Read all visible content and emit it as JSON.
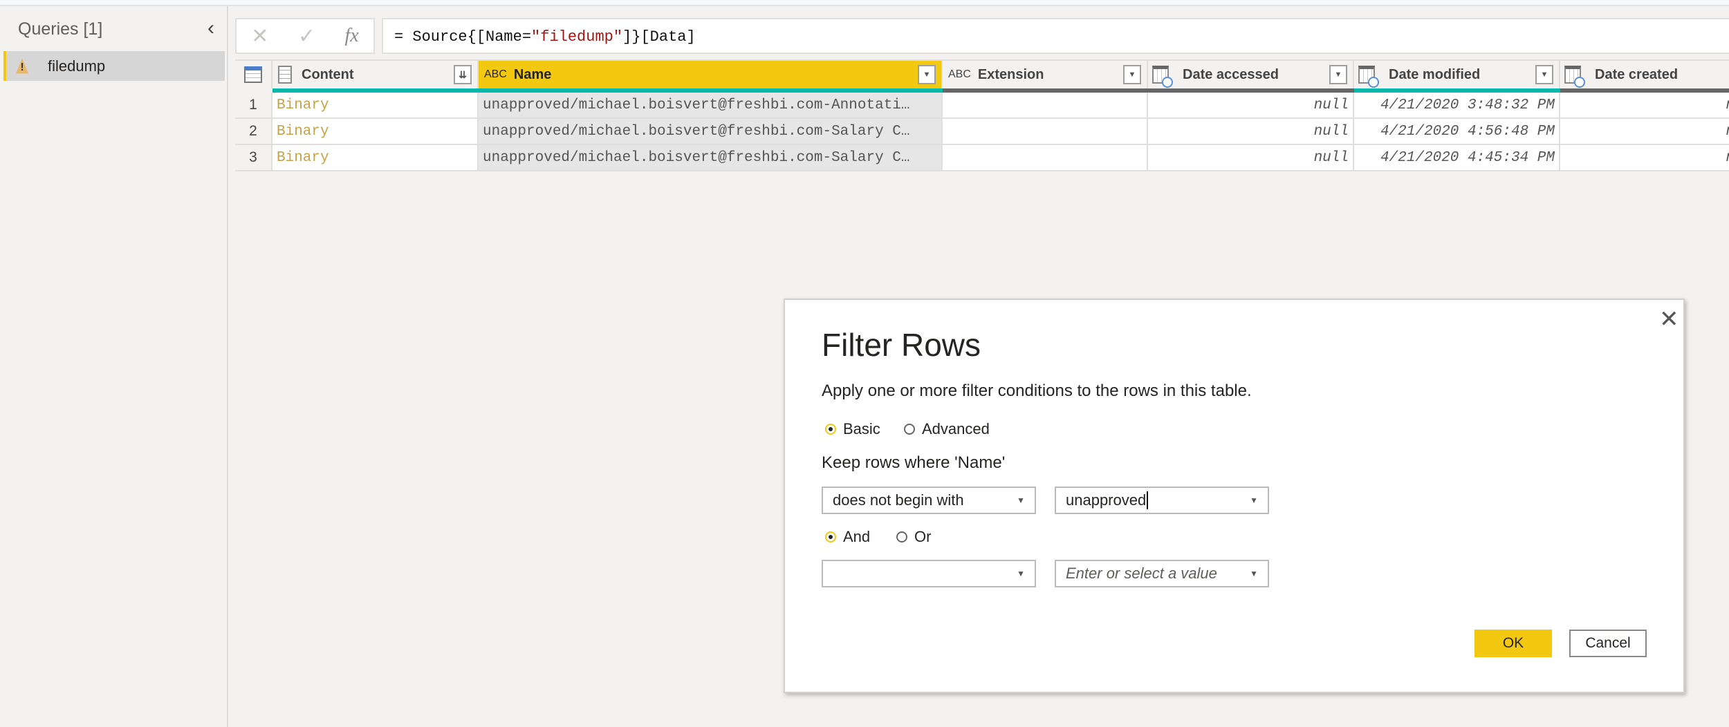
{
  "queries_pane": {
    "title": "Queries [1]",
    "items": [
      {
        "label": "filedump",
        "status": "warning"
      }
    ]
  },
  "formula_bar": {
    "cancel": "✕",
    "commit": "✓",
    "fx": "fx",
    "prefix": "= Source{[Name=",
    "string": "\"filedump\"",
    "suffix": "]}[Data]"
  },
  "table": {
    "columns": [
      {
        "label": "Content",
        "type_icon": "binary-icon"
      },
      {
        "label": "Name",
        "type_icon": "text-icon",
        "type_text": "ABC",
        "selected": true
      },
      {
        "label": "Extension",
        "type_icon": "text-icon",
        "type_text": "ABC"
      },
      {
        "label": "Date accessed",
        "type_icon": "datetime-icon"
      },
      {
        "label": "Date modified",
        "type_icon": "datetime-icon"
      },
      {
        "label": "Date created",
        "type_icon": "datetime-icon"
      }
    ],
    "rows": [
      {
        "n": "1",
        "content": "Binary",
        "name": "unapproved/michael.boisvert@freshbi.com-Annotati…",
        "extension": "",
        "date_accessed": "null",
        "date_modified": "4/21/2020 3:48:32 PM",
        "date_created": "n"
      },
      {
        "n": "2",
        "content": "Binary",
        "name": "unapproved/michael.boisvert@freshbi.com-Salary C…",
        "extension": "",
        "date_accessed": "null",
        "date_modified": "4/21/2020 4:56:48 PM",
        "date_created": "n"
      },
      {
        "n": "3",
        "content": "Binary",
        "name": "unapproved/michael.boisvert@freshbi.com-Salary C…",
        "extension": "",
        "date_accessed": "null",
        "date_modified": "4/21/2020 4:45:34 PM",
        "date_created": "n"
      }
    ]
  },
  "dialog": {
    "title": "Filter Rows",
    "description": "Apply one or more filter conditions to the rows in this table.",
    "mode_basic": "Basic",
    "mode_advanced": "Advanced",
    "mode_selected": "Basic",
    "keep_label": "Keep rows where 'Name'",
    "condition1": {
      "operator": "does not begin with",
      "value": "unapproved"
    },
    "and_label": "And",
    "or_label": "Or",
    "logic_selected": "And",
    "condition2": {
      "operator": "",
      "value_placeholder": "Enter or select a value"
    },
    "ok": "OK",
    "cancel": "Cancel"
  },
  "colors": {
    "accent": "#f2c811",
    "quality_valid": "#01b8aa",
    "quality_empty": "#666666",
    "binary_text": "#c4a34a"
  }
}
